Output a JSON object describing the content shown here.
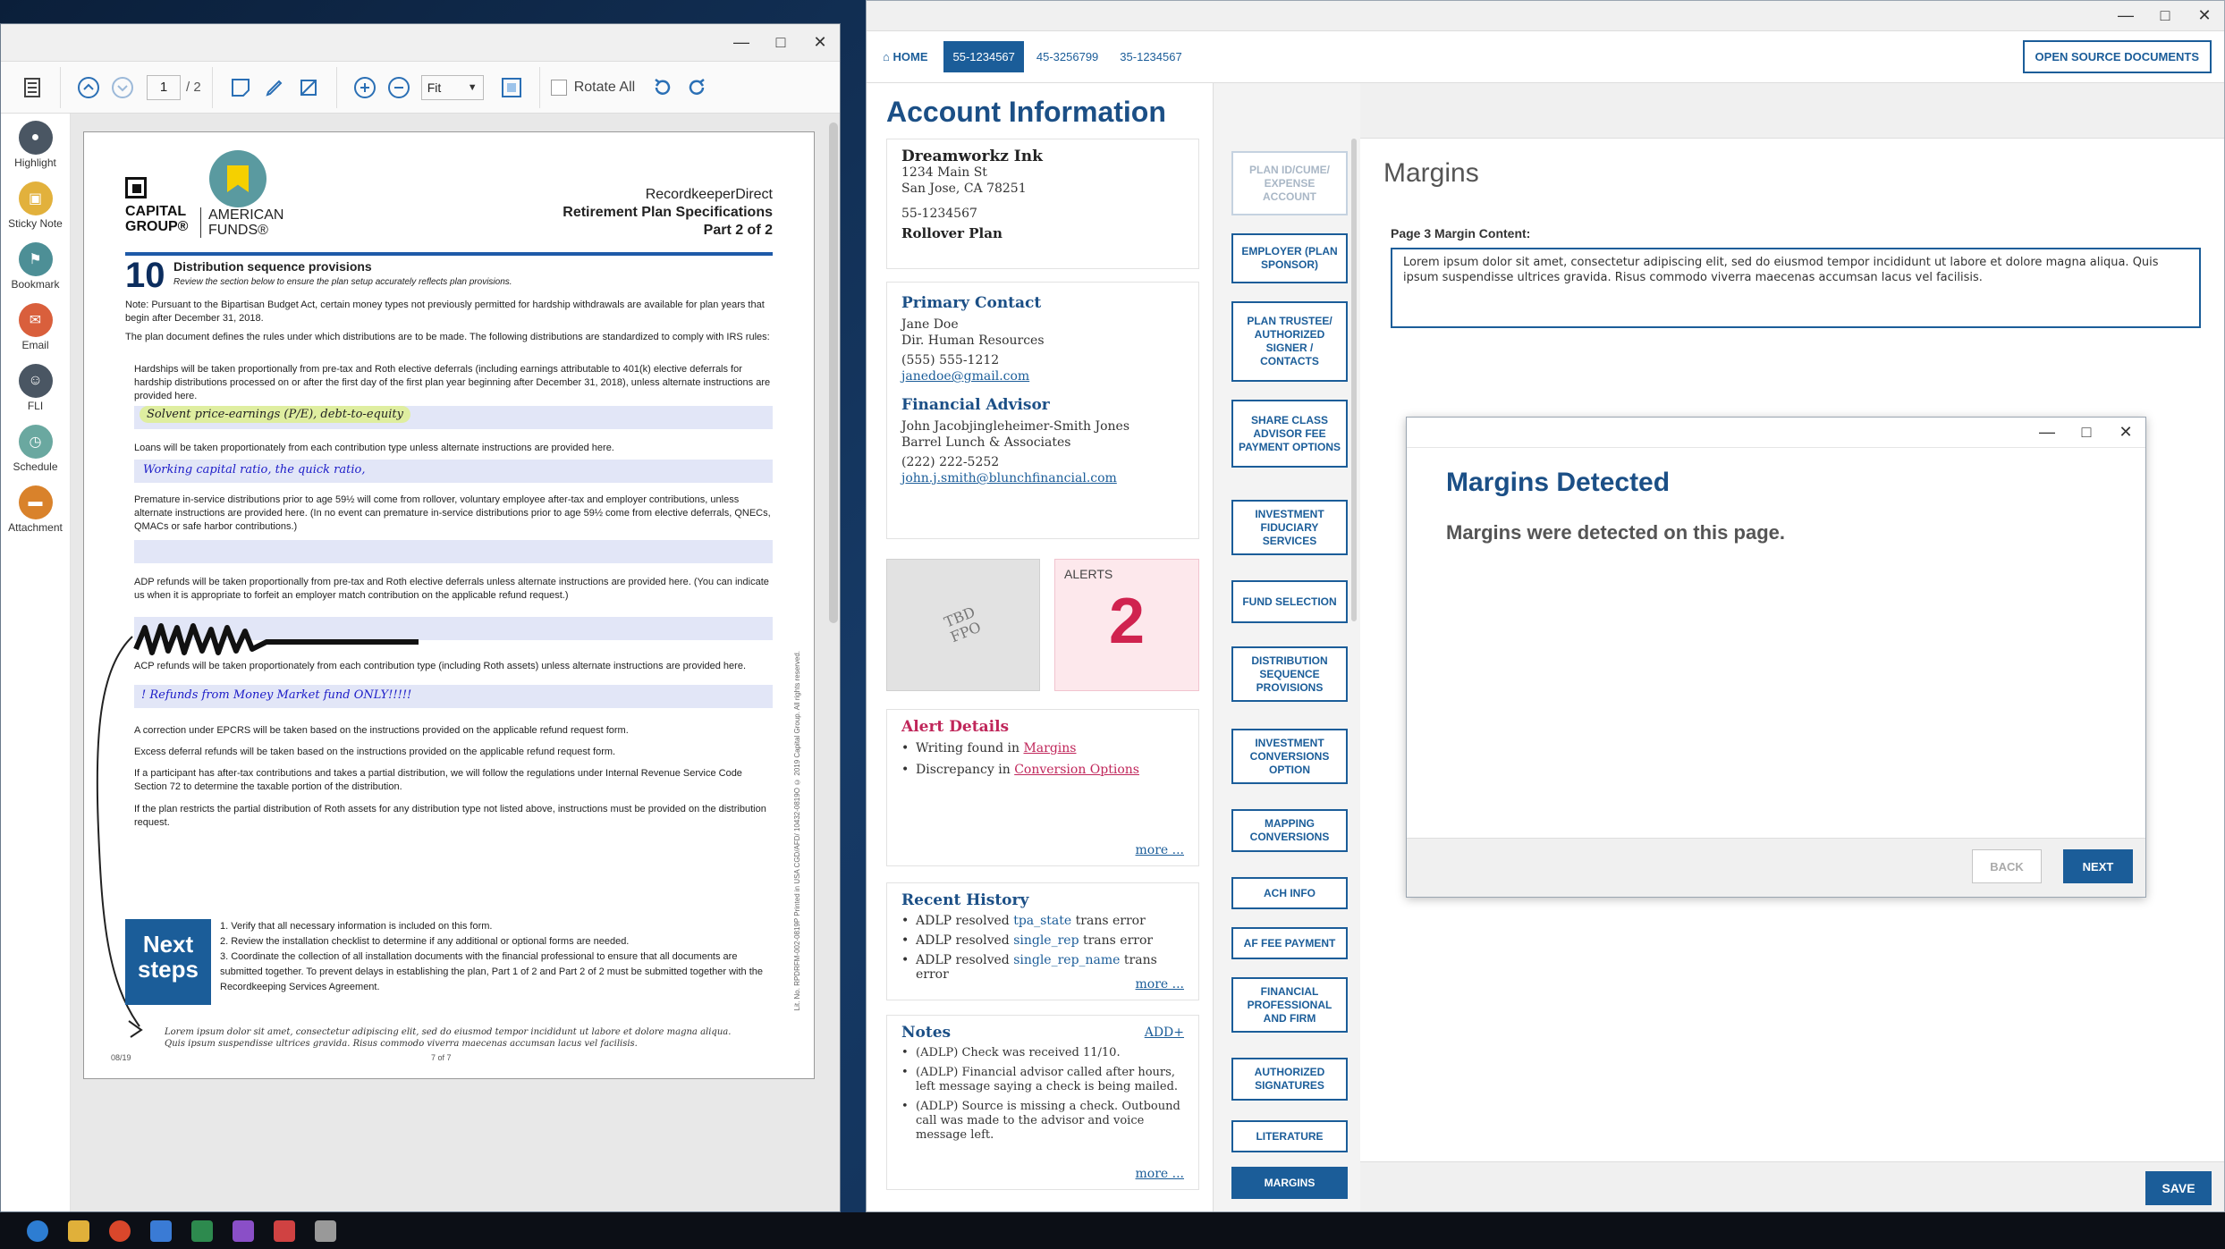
{
  "pdf_viewer": {
    "window_controls": {
      "minimize": "—",
      "maximize": "□",
      "close": "✕"
    },
    "toolbar": {
      "page_current": "1",
      "page_total": "/ 2",
      "zoom_select": "Fit",
      "rotate_all_label": "Rotate All"
    },
    "side_tools": [
      {
        "label": "Highlight",
        "color": "#4a5663"
      },
      {
        "label": "Sticky Note",
        "color": "#e2b13c"
      },
      {
        "label": "Bookmark",
        "color": "#4d8f96"
      },
      {
        "label": "Email",
        "color": "#d95f3c"
      },
      {
        "label": "FLI",
        "color": "#4a5663"
      },
      {
        "label": "Schedule",
        "color": "#6aa8a0"
      },
      {
        "label": "Attachment",
        "color": "#d9822b"
      }
    ],
    "document": {
      "logo_left": "CAPITAL\nGROUP®",
      "logo_right": "AMERICAN\nFUNDS®",
      "header_line1": "RecordkeeperDirect",
      "header_line2": "Retirement Plan Specifications",
      "header_line3": "Part 2 of 2",
      "section_number": "10",
      "section_title": "Distribution sequence provisions",
      "section_subtitle": "Review the section below to ensure the plan setup accurately reflects plan provisions.",
      "note": "Note:  Pursuant to the Bipartisan Budget Act, certain money types not previously permitted for hardship withdrawals are available for plan years that begin after December 31, 2018.",
      "intro": "The plan document defines the rules under which distributions are to be made. The following distributions are standardized to comply with IRS rules:",
      "hardships": "Hardships will be taken proportionally from pre-tax and Roth elective deferrals (including earnings attributable to 401(k) elective deferrals for hardship distributions processed on or after the first day of the first plan year beginning after December 31, 2018), unless alternate instructions are provided here.",
      "hw_hardships": "Solvent price-earnings (P/E), debt-to-equity",
      "loans": "Loans will be taken proportionately from each contribution type unless alternate instructions are provided here.",
      "hw_loans": "Working capital ratio, the quick ratio,",
      "premature": "Premature in-service distributions prior to age 59½ will come from rollover, voluntary employee after-tax and employer contributions, unless alternate instructions are provided here. (In no event can premature in-service distributions prior to age 59½ come from elective deferrals, QNECs, QMACs or safe harbor contributions.)",
      "adp": "ADP refunds will be taken proportionally from pre-tax and Roth elective deferrals unless alternate instructions are provided here. (You can indicate us when it is appropriate to forfeit an employer match contribution on the applicable refund request.)",
      "acp": "ACP refunds will be taken proportionately from each contribution type (including Roth assets) unless alternate instructions are provided here.",
      "hw_acp": "! Refunds from Money Market fund ONLY!!!!!",
      "epcrs": "A correction under EPCRS will be taken based on the instructions provided on the applicable refund request form.",
      "excess": "Excess deferral refunds will be taken based on the instructions provided on the applicable refund request form.",
      "aftertax": "If a participant has after-tax contributions and takes a partial distribution, we will follow the regulations under Internal Revenue Service Code Section 72 to determine the taxable portion of the distribution.",
      "roth": "If the plan restricts the partial distribution of Roth assets for any distribution type not listed above, instructions must be provided on the distribution request.",
      "next_steps_title": "Next steps",
      "next_steps": [
        "1.  Verify that all necessary information is included on this form.",
        "2.  Review the installation checklist to determine if any additional or optional forms are needed.",
        "3.  Coordinate the collection of all installation documents with the financial professional to ensure that all documents are submitted together. To prevent delays in establishing the plan, Part 1 of 2 and Part 2 of 2 must be submitted together with the Recordkeeping Services Agreement."
      ],
      "signature_text": "Lorem ipsum dolor sit amet, consectetur adipiscing elit, sed do eiusmod tempor incididunt ut labore et dolore magna aliqua. Quis ipsum suspendisse ultrices gravida. Risus commodo viverra maecenas accumsan lacus vel facilisis.",
      "footer_left": "08/19",
      "footer_page": "7 of 7",
      "vertical_text": "Lit. No. RPDRFM-002-0819P   Printed in USA   CGD/AFD/ 10432-0819O   © 2019 Capital Group. All rights reserved."
    }
  },
  "app": {
    "window_controls": {
      "minimize": "—",
      "maximize": "□",
      "close": "✕"
    },
    "nav": {
      "home": "HOME",
      "tabs": [
        "55-1234567",
        "45-3256799",
        "35-1234567"
      ],
      "open_source_docs": "OPEN SOURCE DOCUMENTS"
    },
    "account": {
      "title": "Account Information",
      "company": "Dreamworkz Ink",
      "address1": "1234 Main St",
      "address2": "San Jose, CA 78251",
      "account_no": "55-1234567",
      "plan_type": "Rollover Plan",
      "primary_contact_h": "Primary Contact",
      "pc_name": "Jane Doe",
      "pc_title": "Dir. Human Resources",
      "pc_phone": "(555) 555-1212",
      "pc_email": "janedoe@gmail.com",
      "advisor_h": "Financial Advisor",
      "fa_name": "John Jacobjingleheimer-Smith Jones",
      "fa_firm": "Barrel Lunch & Associates",
      "fa_phone": "(222) 222-5252",
      "fa_email": "john.j.smith@blunchfinancial.com",
      "tbd": "TBD\nFPO",
      "alerts_label": "ALERTS",
      "alerts_count": "2",
      "alert_details_h": "Alert Details",
      "alert1_text": "Writing found in ",
      "alert1_link": "Margins",
      "alert2_text": "Discrepancy in ",
      "alert2_link": "Conversion Options",
      "more": "more ...",
      "history_h": "Recent History",
      "history": [
        {
          "prefix": "ADLP resolved ",
          "link": "tpa_state",
          "suffix": " trans error"
        },
        {
          "prefix": "ADLP resolved ",
          "link": "single_rep",
          "suffix": " trans error"
        },
        {
          "prefix": "ADLP resolved ",
          "link": "single_rep_name",
          "suffix": " trans error"
        }
      ],
      "notes_h": "Notes",
      "notes_add": "ADD+",
      "notes": [
        "(ADLP) Check was received 11/10.",
        "(ADLP) Financial advisor called after hours, left message saying a check is being mailed.",
        "(ADLP) Source is missing a check. Outbound call was made to the advisor and voice message left."
      ]
    },
    "side_nav": [
      "PLAN ID/CUME/ EXPENSE ACCOUNT",
      "EMPLOYER (PLAN SPONSOR)",
      "PLAN TRUSTEE/ AUTHORIZED SIGNER / CONTACTS",
      "SHARE CLASS ADVISOR FEE PAYMENT OPTIONS",
      "INVESTMENT FIDUCIARY SERVICES",
      "FUND SELECTION",
      "DISTRIBUTION SEQUENCE PROVISIONS",
      "INVESTMENT CONVERSIONS OPTION",
      "MAPPING CONVERSIONS",
      "ACH INFO",
      "AF FEE PAYMENT",
      "FINANCIAL PROFESSIONAL AND FIRM",
      "AUTHORIZED SIGNATURES",
      "LITERATURE",
      "MARGINS"
    ],
    "main": {
      "title": "Margins",
      "margin_label": "Page 3 Margin Content:",
      "margin_value": "Lorem ipsum dolor sit amet, consectetur adipiscing elit, sed do eiusmod tempor incididunt ut labore et dolore magna aliqua. Quis ipsum suspendisse ultrices gravida. Risus commodo viverra maecenas accumsan lacus vel facilisis.",
      "save": "SAVE"
    },
    "modal": {
      "title": "Margins Detected",
      "message": "Margins were detected on this page.",
      "back": "BACK",
      "next": "NEXT"
    }
  },
  "colors": {
    "brand": "#1b5d99",
    "alert": "#d0234f",
    "alert_bg": "#fde8ec"
  }
}
